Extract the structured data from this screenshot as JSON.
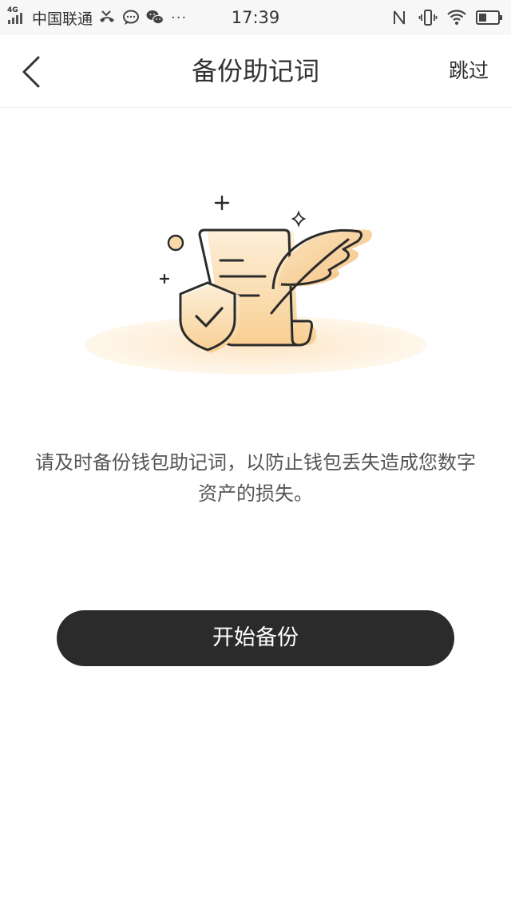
{
  "status_bar": {
    "network_label": "4G",
    "carrier": "中国联通",
    "time": "17:39",
    "left_icons": [
      "missed-call-icon",
      "message-bubble-icon",
      "wechat-icon"
    ],
    "more_indicator": "···",
    "right_icons": [
      "nfc-icon",
      "vibrate-icon",
      "wifi-icon",
      "battery-icon"
    ]
  },
  "nav": {
    "back_icon": "chevron-left-icon",
    "title": "备份助记词",
    "skip_label": "跳过"
  },
  "illustration": {
    "icons": [
      "document-icon",
      "quill-feather-icon",
      "shield-check-icon",
      "sparkle-icon"
    ],
    "colors": {
      "accent": "#F7C98A",
      "light": "#FDEBD0",
      "outline": "#2b2b2b"
    }
  },
  "content": {
    "description_line1": "请及时备份钱包助记词，以防止钱包丢失造成您数字",
    "description_line2": "资产的损失。"
  },
  "action": {
    "start_label": "开始备份",
    "button_color": "#2b2b2b"
  }
}
